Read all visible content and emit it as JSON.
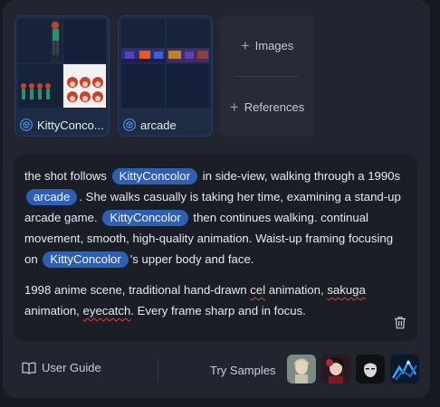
{
  "references": [
    {
      "label": "KittyConco..."
    },
    {
      "label": "arcade"
    }
  ],
  "add_panel": {
    "images_label": "Images",
    "references_label": "References"
  },
  "prompt": {
    "p1": {
      "t1": "the shot follows",
      "tag1": "KittyConcolor",
      "t2": "in side-view, walking through a 1990s",
      "tag2": "arcade",
      "t3": ". She walks casually is taking her time, examining a stand-up arcade game.",
      "tag3": "KittyConcolor",
      "t4": "then continues walking. continual movement, smooth, high-quality animation.  Waist-up framing focusing on",
      "tag4": "KittyConcolor",
      "t5": "'s upper body and face."
    },
    "p2": {
      "t1": "1998 anime scene, traditional hand-drawn",
      "w1": "cel",
      "t2": "animation,",
      "w2": "sakuga",
      "t3": "animation,",
      "w3": "eyecatch",
      "t4": ". Every frame sharp and in focus."
    }
  },
  "footer": {
    "guide_label": "User Guide",
    "try_label": "Try Samples",
    "samples": [
      "sample-1",
      "sample-2",
      "sample-3",
      "sample-4"
    ]
  },
  "colors": {
    "tag_bg": "#2f5fb3",
    "card_bg": "#1d2b44",
    "cube_icon": "#4a8fe6"
  },
  "icons": [
    "cube-icon",
    "plus-icon",
    "trash-icon",
    "book-icon"
  ]
}
